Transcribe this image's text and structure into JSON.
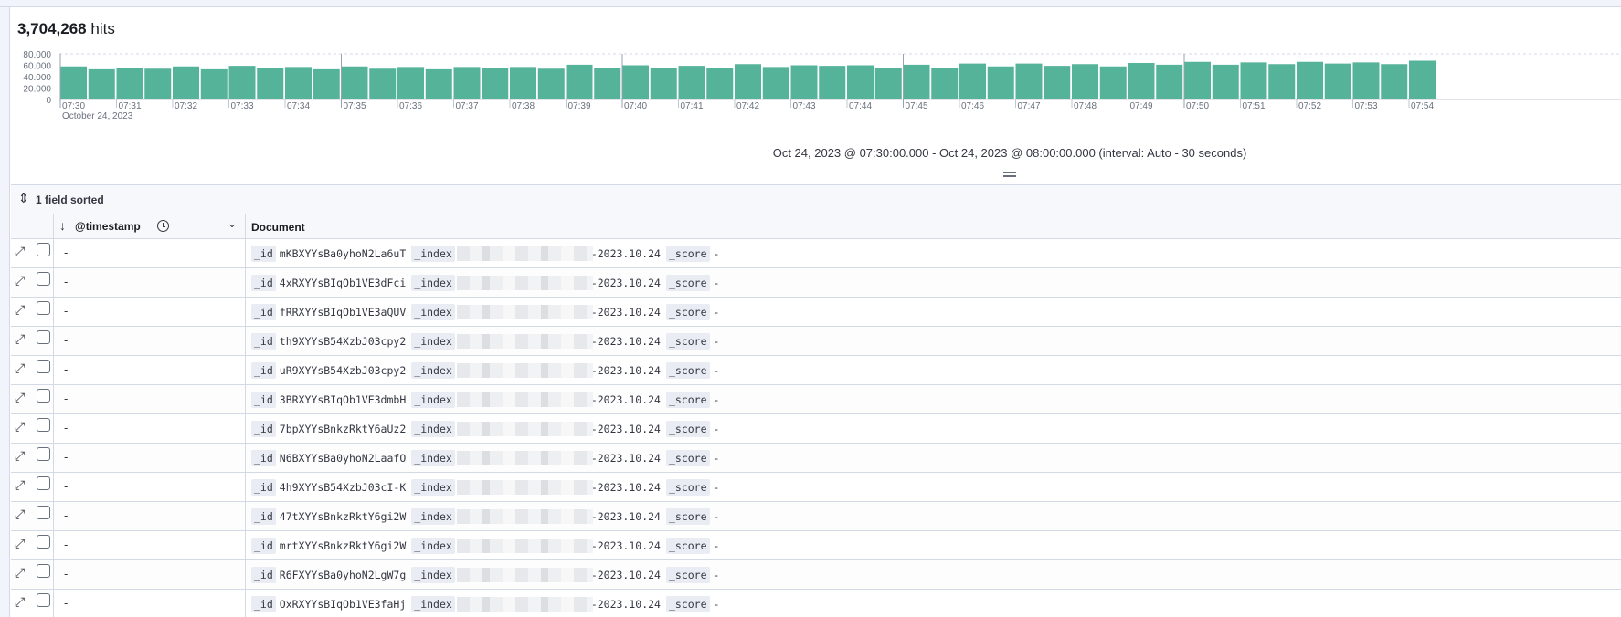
{
  "hits": {
    "count": "3,704,268",
    "label": "hits"
  },
  "chart_data": {
    "type": "bar",
    "ylim": [
      0,
      80000
    ],
    "yticks": [
      "80.000",
      "60.000",
      "40.000",
      "20.000",
      "0"
    ],
    "xticks": [
      "07:30",
      "07:31",
      "07:32",
      "07:33",
      "07:34",
      "07:35",
      "07:36",
      "07:37",
      "07:38",
      "07:39",
      "07:40",
      "07:41",
      "07:42",
      "07:43",
      "07:44",
      "07:45",
      "07:46",
      "07:47",
      "07:48",
      "07:49",
      "07:50",
      "07:51",
      "07:52",
      "07:53",
      "07:54"
    ],
    "date_label": "October 24, 2023",
    "bar_color": "#54b399",
    "values": [
      58000,
      53000,
      56000,
      54000,
      58000,
      53000,
      59000,
      55000,
      57000,
      53000,
      58000,
      54000,
      57000,
      53000,
      57000,
      55000,
      57000,
      54000,
      61000,
      56000,
      60000,
      55000,
      59000,
      56000,
      62000,
      57000,
      60000,
      59000,
      60000,
      56000,
      61000,
      56000,
      63000,
      58000,
      63000,
      59000,
      62000,
      58000,
      64000,
      61000,
      66000,
      61000,
      65000,
      62000,
      66000,
      63000,
      65000,
      62000,
      68000
    ]
  },
  "time_range": "Oct 24, 2023 @ 07:30:00.000 - Oct 24, 2023 @ 08:00:00.000 (interval: Auto - 30 seconds)",
  "toolbar": {
    "sort_label": "1 field sorted"
  },
  "grid": {
    "columns": {
      "timestamp": "@timestamp",
      "document": "Document"
    },
    "keys": {
      "id": "_id",
      "index": "_index",
      "score": "_score"
    },
    "rows": [
      {
        "timestamp": "-",
        "id": "mKBXYYsBa0yhoN2La6uT",
        "index_suffix": "-2023.10.24",
        "score": "-"
      },
      {
        "timestamp": "-",
        "id": "4xRXYYsBIqOb1VE3dFci",
        "index_suffix": "-2023.10.24",
        "score": "-"
      },
      {
        "timestamp": "-",
        "id": "fRRXYYsBIqOb1VE3aQUV",
        "index_suffix": "-2023.10.24",
        "score": "-"
      },
      {
        "timestamp": "-",
        "id": "th9XYYsB54XzbJ03cpy2",
        "index_suffix": "-2023.10.24",
        "score": "-"
      },
      {
        "timestamp": "-",
        "id": "uR9XYYsB54XzbJ03cpy2",
        "index_suffix": "-2023.10.24",
        "score": "-"
      },
      {
        "timestamp": "-",
        "id": "3BRXYYsBIqOb1VE3dmbH",
        "index_suffix": "-2023.10.24",
        "score": "-"
      },
      {
        "timestamp": "-",
        "id": "7bpXYYsBnkzRktY6aUz2",
        "index_suffix": "-2023.10.24",
        "score": "-"
      },
      {
        "timestamp": "-",
        "id": "N6BXYYsBa0yhoN2LaafO",
        "index_suffix": "-2023.10.24",
        "score": "-"
      },
      {
        "timestamp": "-",
        "id": "4h9XYYsB54XzbJ03cI-K",
        "index_suffix": "-2023.10.24",
        "score": "-"
      },
      {
        "timestamp": "-",
        "id": "47tXYYsBnkzRktY6gi2W",
        "index_suffix": "-2023.10.24",
        "score": "-"
      },
      {
        "timestamp": "-",
        "id": "mrtXYYsBnkzRktY6gi2W",
        "index_suffix": "-2023.10.24",
        "score": "-"
      },
      {
        "timestamp": "-",
        "id": "R6FXYYsBa0yhoN2LgW7g",
        "index_suffix": "-2023.10.24",
        "score": "-"
      },
      {
        "timestamp": "-",
        "id": "OxRXYYsBIqOb1VE3faHj",
        "index_suffix": "-2023.10.24",
        "score": "-"
      }
    ]
  }
}
